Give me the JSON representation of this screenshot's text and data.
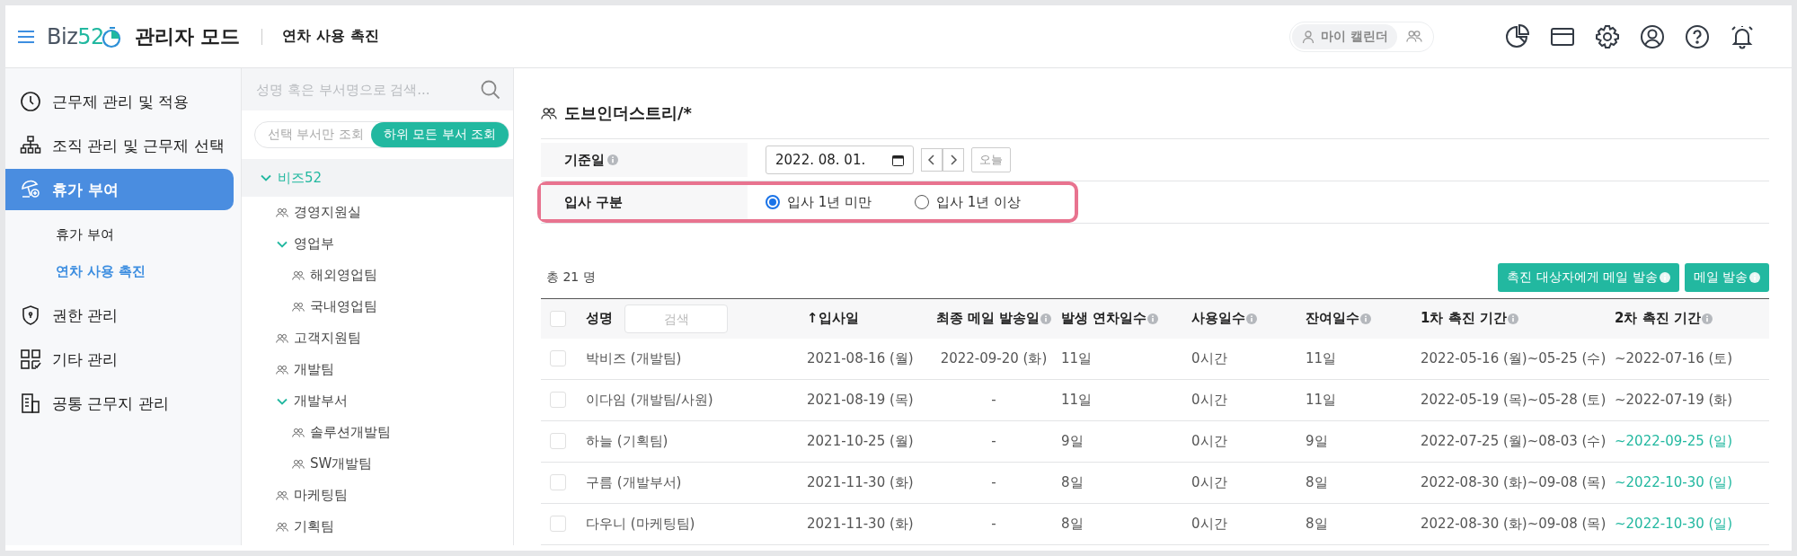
{
  "header": {
    "logo": {
      "text": "Biz",
      "accent": "52"
    },
    "mode_title": "관리자 모드",
    "page_title": "연차 사용 촉진",
    "calendar_switch": [
      {
        "kind": "personal",
        "label": "마이 캘린더",
        "selected": true
      },
      {
        "kind": "team",
        "selected": false
      }
    ],
    "icons": [
      {
        "kind": "chart"
      },
      {
        "kind": "card"
      },
      {
        "kind": "settings"
      },
      {
        "kind": "account"
      },
      {
        "kind": "help"
      },
      {
        "kind": "bell"
      }
    ]
  },
  "sidebar": {
    "items": [
      {
        "kind": "clock",
        "label": "근무제 관리 및 적용",
        "selected": false
      },
      {
        "kind": "org",
        "label": "조직 관리 및 근무제 선택",
        "selected": false
      },
      {
        "kind": "umbrella",
        "label": "휴가 부여",
        "selected": true,
        "children": [
          {
            "label": "휴가 부여",
            "selected": false
          },
          {
            "label": "연차 사용 촉진",
            "selected": true
          }
        ]
      },
      {
        "kind": "shield",
        "label": "권한 관리",
        "selected": false
      },
      {
        "kind": "grid",
        "label": "기타 관리",
        "selected": false
      },
      {
        "kind": "building",
        "label": "공통 근무지 관리",
        "selected": false
      }
    ]
  },
  "org_tree": {
    "search": {
      "placeholder": "성명 혹은 부서명으로 검색..."
    },
    "scope_options": [
      {
        "label": "선택 부서만 조회",
        "selected": false
      },
      {
        "label": "하위 모든 부서 조회",
        "selected": true
      }
    ],
    "nodes": [
      {
        "label": "비즈52",
        "selected": true,
        "expanded": true,
        "children": [
          {
            "label": "경영지원실",
            "selected": false
          },
          {
            "label": "영업부",
            "selected": false,
            "expanded": true,
            "children": [
              {
                "label": "해외영업팀",
                "selected": false
              },
              {
                "label": "국내영업팀",
                "selected": false
              }
            ]
          },
          {
            "label": "고객지원팀",
            "selected": false
          },
          {
            "label": "개발팀",
            "selected": false
          },
          {
            "label": "개발부서",
            "selected": false,
            "expanded": true,
            "children": [
              {
                "label": "솔루션개발팀",
                "selected": false
              },
              {
                "label": "SW개발팀",
                "selected": false
              }
            ]
          },
          {
            "label": "마케팅팀",
            "selected": false
          },
          {
            "label": "기획팀",
            "selected": false
          }
        ]
      }
    ]
  },
  "main": {
    "org_title": "도브인더스트리/*",
    "filters": [
      {
        "kind": "date",
        "label": "기준일",
        "info": true,
        "highlighted": false,
        "value": "2022. 08. 01.",
        "today_button": "오늘"
      },
      {
        "kind": "radio",
        "label": "입사 구분",
        "highlighted": true,
        "options": [
          {
            "label": "입사 1년 미만",
            "selected": true
          },
          {
            "label": "입사 1년 이상",
            "selected": false
          }
        ]
      }
    ],
    "total": "총 21 명",
    "buttons": [
      {
        "label": "촉진 대상자에게 메일 발송",
        "info": true
      },
      {
        "label": "메일 발송",
        "info": true
      }
    ],
    "table": {
      "all_checked": false,
      "columns": [
        {
          "label": "성명",
          "search_placeholder": "검색"
        },
        {
          "label": "↑입사일"
        },
        {
          "label": "최종 메일 발송일",
          "info": true
        },
        {
          "label": "발생 연차일수",
          "info": true
        },
        {
          "label": "사용일수",
          "info": true
        },
        {
          "label": "잔여일수",
          "info": true
        },
        {
          "label": "1차 촉진 기간",
          "info": true
        },
        {
          "label": "2차 촉진 기간",
          "info": true
        }
      ],
      "rows": [
        {
          "checked": false,
          "name": "박비즈 (개발팀)",
          "join_date": "2021-08-16 (월)",
          "last_mail": "2022-09-20 (화)",
          "granted": "11일",
          "used": "0시간",
          "remaining": "11일",
          "first_period": "2022-05-16 (월)~05-25 (수)",
          "second_period": "~2022-07-16 (토)",
          "second_period_highlighted": false
        },
        {
          "checked": false,
          "name": "이다임 (개발팀/사원)",
          "join_date": "2021-08-19 (목)",
          "last_mail": "-",
          "granted": "11일",
          "used": "0시간",
          "remaining": "11일",
          "first_period": "2022-05-19 (목)~05-28 (토)",
          "second_period": "~2022-07-19 (화)",
          "second_period_highlighted": false
        },
        {
          "checked": false,
          "name": "하늘 (기획팀)",
          "join_date": "2021-10-25 (월)",
          "last_mail": "-",
          "granted": "9일",
          "used": "0시간",
          "remaining": "9일",
          "first_period": "2022-07-25 (월)~08-03 (수)",
          "second_period": "~2022-09-25 (일)",
          "second_period_highlighted": true
        },
        {
          "checked": false,
          "name": "구름 (개발부서)",
          "join_date": "2021-11-30 (화)",
          "last_mail": "-",
          "granted": "8일",
          "used": "0시간",
          "remaining": "8일",
          "first_period": "2022-08-30 (화)~09-08 (목)",
          "second_period": "~2022-10-30 (일)",
          "second_period_highlighted": true
        },
        {
          "checked": false,
          "name": "다우니 (마케팅팀)",
          "join_date": "2021-11-30 (화)",
          "last_mail": "-",
          "granted": "8일",
          "used": "0시간",
          "remaining": "8일",
          "first_period": "2022-08-30 (화)~09-08 (목)",
          "second_period": "~2022-10-30 (일)",
          "second_period_highlighted": true
        }
      ]
    }
  }
}
